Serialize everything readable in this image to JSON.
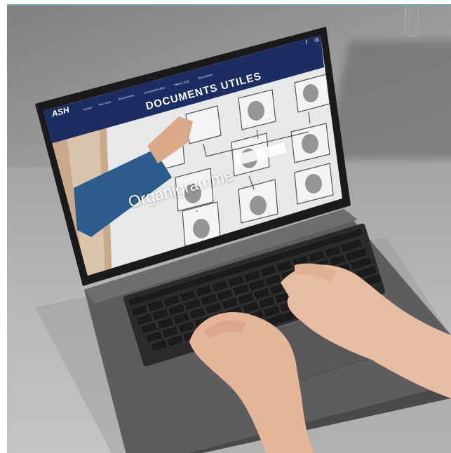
{
  "site": {
    "logo": "ASH",
    "nav": [
      "Accueil",
      "Nos cours",
      "Nos services",
      "Documents utiles",
      "Tâlents 2025",
      "Nos actions"
    ],
    "page_title": "DOCUMENTS UTILES",
    "hero_label": "Organigramme",
    "social": {
      "facebook": "f",
      "instagram": "◎"
    }
  },
  "colors": {
    "header_blue": "#1c2d63",
    "sleeve_blue": "#2c5d8c",
    "laptop_grey": "#5d5d5f",
    "key_black": "#1b1b1d",
    "accent_line": "#6fa3b8"
  }
}
